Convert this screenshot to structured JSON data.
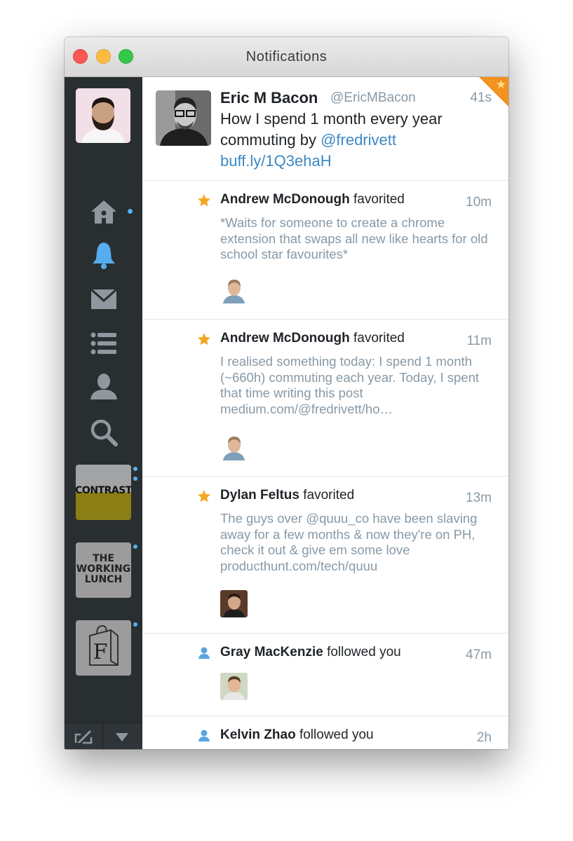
{
  "window": {
    "title": "Notifications"
  },
  "sidebar": {
    "nav": [
      "home-icon",
      "notifications-bell-icon",
      "messages-envelope-icon",
      "lists-icon",
      "profile-icon",
      "search-icon"
    ],
    "columns": [
      {
        "name": "contrast",
        "label": "CONTRAST"
      },
      {
        "name": "working-lunch",
        "label": "THE WORKING LUNCH"
      },
      {
        "name": "f-bag",
        "label": "F"
      }
    ],
    "accent": "#56b0f2"
  },
  "tweet": {
    "name": "Eric M Bacon",
    "handle": "@EricMBacon",
    "time": "41s",
    "text_before": "How I spend 1 month every year commuting by ",
    "mention": "@fredrivett",
    "link": "buff.ly/1Q3ehaH"
  },
  "notifications": [
    {
      "type": "favorite",
      "name": "Andrew McDonough",
      "action": " favorited",
      "time": "10m",
      "text": "*Waits for someone to create a chrome extension that swaps all new like hearts for old school star favourites*"
    },
    {
      "type": "favorite",
      "name": "Andrew McDonough",
      "action": " favorited",
      "time": "11m",
      "text": "I realised something today: I spend 1 month (~660h) commuting each year. Today, I spent that time writing this post medium.com/@fredrivett/ho…"
    },
    {
      "type": "favorite",
      "name": "Dylan Feltus",
      "action": " favorited",
      "time": "13m",
      "text": "The guys over @quuu_co have been slaving away for a few months & now they're on PH, check it out & give em some love producthunt.com/tech/quuu"
    },
    {
      "type": "follow",
      "name": "Gray MacKenzie",
      "action": " followed you",
      "time": "47m",
      "text": ""
    },
    {
      "type": "follow",
      "name": "Kelvin Zhao",
      "action": " followed you",
      "time": "2h",
      "text": ""
    }
  ],
  "colors": {
    "favorite": "#f5a623",
    "follow": "#58a4e0",
    "link": "#3b88c3"
  }
}
